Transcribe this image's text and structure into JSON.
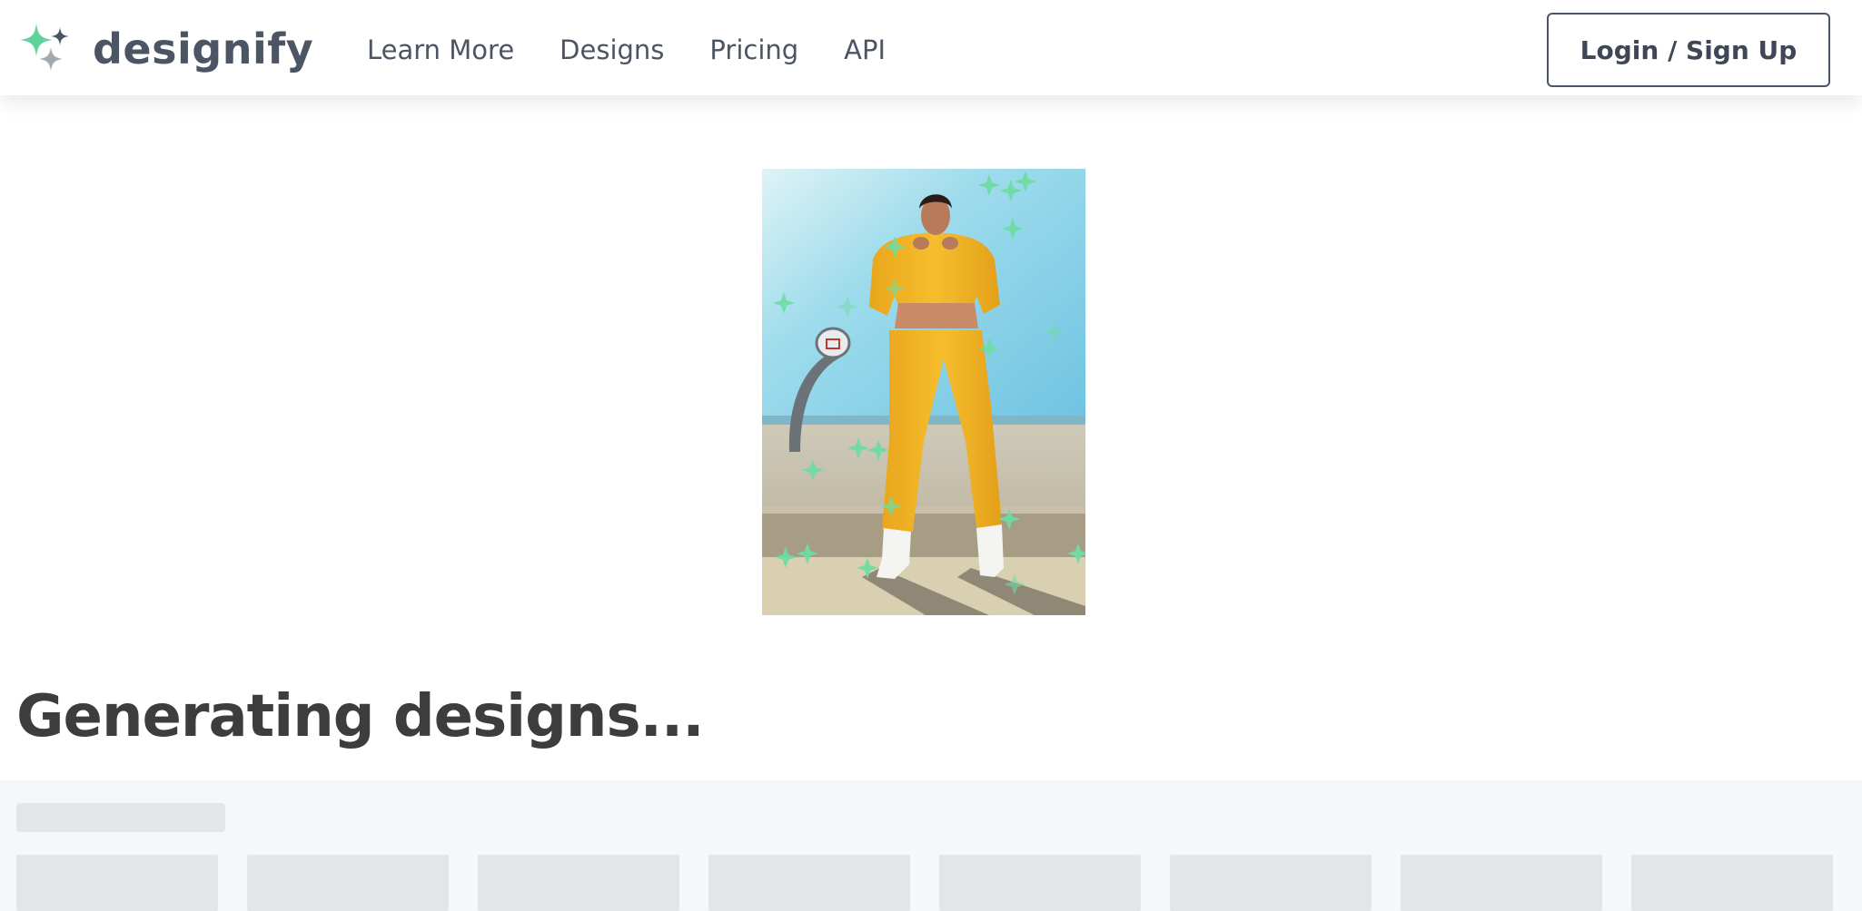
{
  "brand": {
    "name": "designify",
    "logo_icon": "sparkle-icon",
    "colors": {
      "accent": "#5fd39a",
      "secondary": "#9aa1ab"
    }
  },
  "nav": {
    "items": [
      {
        "label": "Learn More"
      },
      {
        "label": "Designs"
      },
      {
        "label": "Pricing"
      },
      {
        "label": "API"
      }
    ]
  },
  "auth": {
    "login_label": "Login / Sign Up"
  },
  "main": {
    "status_title": "Generating designs..."
  }
}
